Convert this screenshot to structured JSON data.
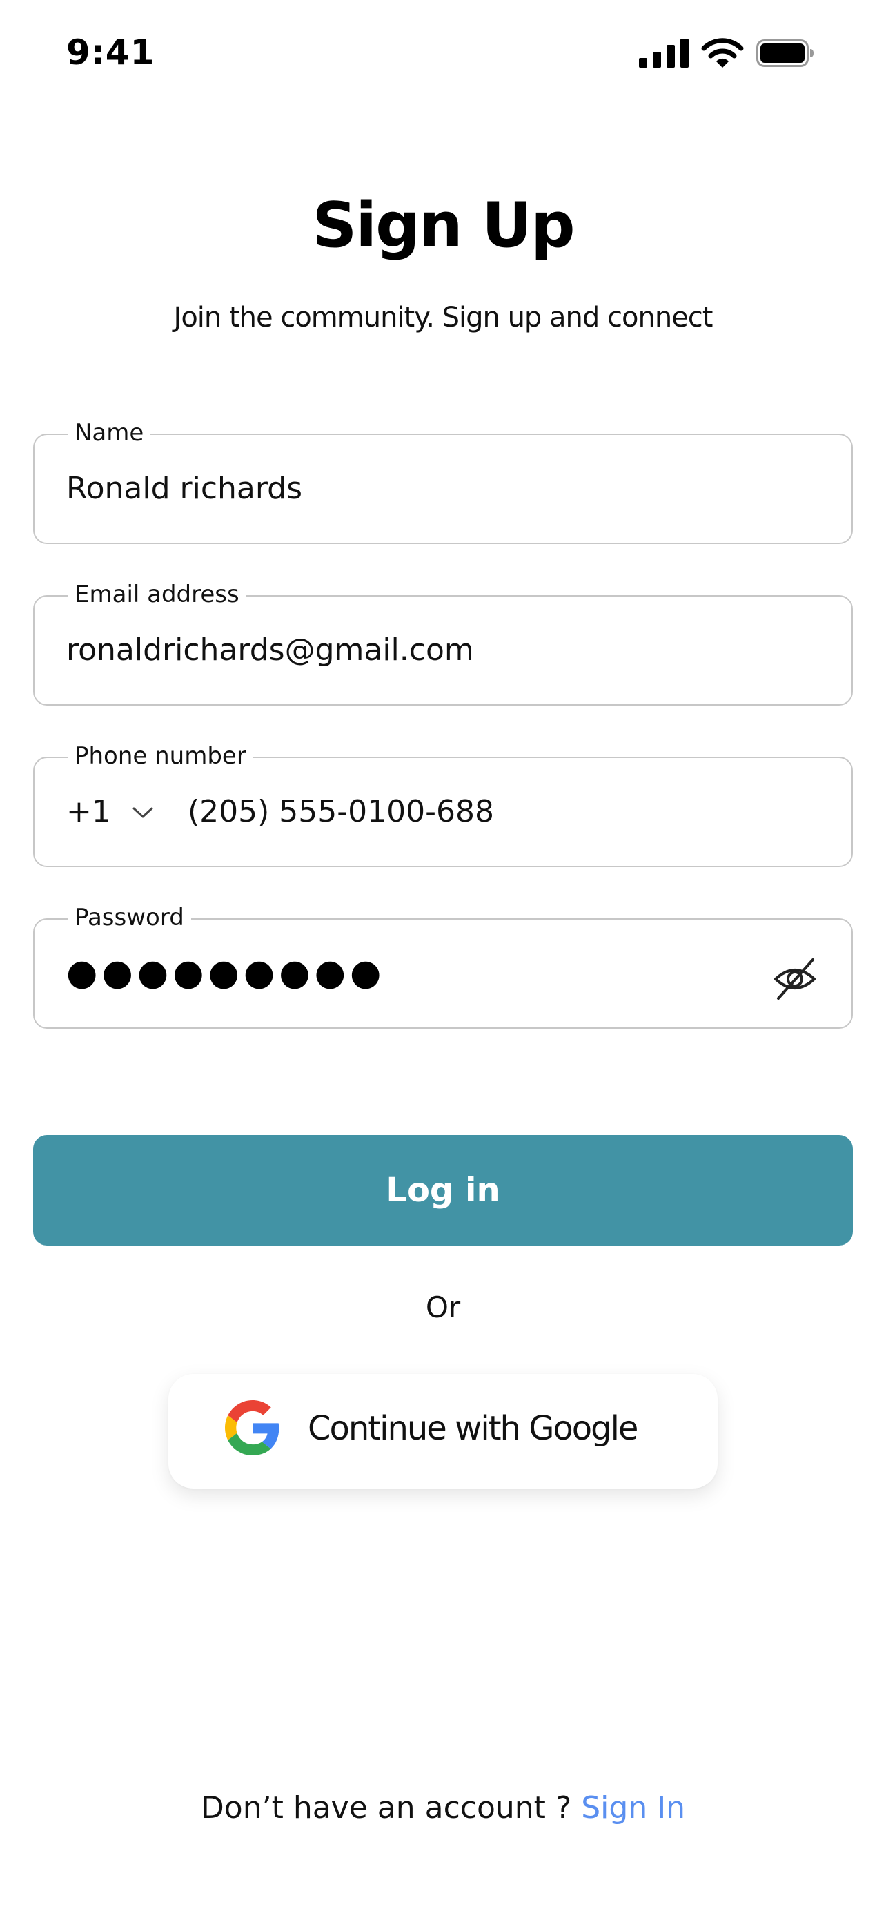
{
  "status_bar": {
    "time": "9:41"
  },
  "header": {
    "title": "Sign Up",
    "subtitle": "Join the community. Sign up and connect"
  },
  "form": {
    "name": {
      "label": "Name",
      "value": "Ronald richards"
    },
    "email": {
      "label": "Email address",
      "value": "ronaldrichards@gmail.com"
    },
    "phone": {
      "label": "Phone number",
      "country_code": "+1",
      "value": "(205) 555-0100-688"
    },
    "password": {
      "label": "Password",
      "masked_value": "●●●●●●●●●",
      "toggle_icon": "eye-off-icon"
    }
  },
  "actions": {
    "login_label": "Log in",
    "divider_text": "Or",
    "google_label": "Continue with Google"
  },
  "footer": {
    "prompt": "Don’t have an account ?",
    "link_label": "Sign In"
  },
  "colors": {
    "primary": "#4293a5",
    "link": "#5a8ff0",
    "field_border": "#c7c7c7"
  }
}
